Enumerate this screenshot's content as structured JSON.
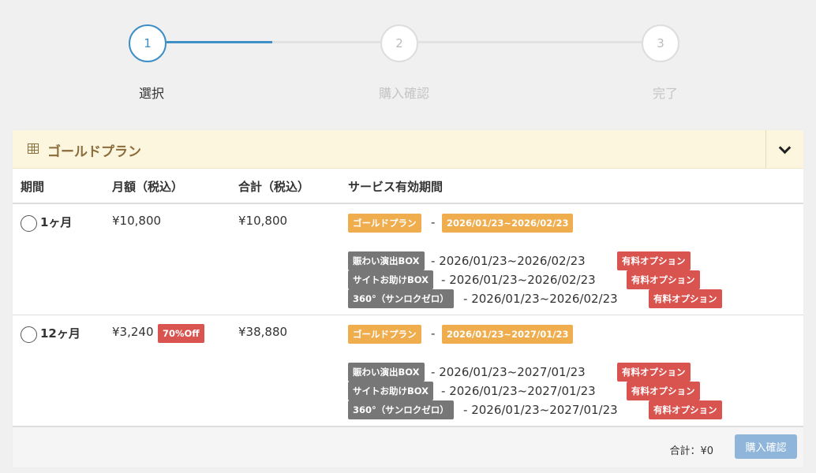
{
  "stepper": {
    "steps": [
      {
        "number": "1",
        "label": "選択"
      },
      {
        "number": "2",
        "label": "購入確認"
      },
      {
        "number": "3",
        "label": "完了"
      }
    ],
    "active_color": "#3d8fc6"
  },
  "panel": {
    "title": "ゴールドプラン",
    "icon": "table-icon",
    "collapse_icon": "chevron-down-icon"
  },
  "table": {
    "headers": [
      "期間",
      "月額（税込）",
      "合計（税込）",
      "サービス有効期間"
    ],
    "rows": [
      {
        "period": "1ヶ月",
        "monthly": "¥10,800",
        "discount": "",
        "total": "¥10,800",
        "plan_badge": "ゴールドプラン",
        "plan_dates": "2026/01/23~2026/02/23",
        "options": [
          {
            "name": "賑わい演出BOX",
            "dates": "2026/01/23~2026/02/23",
            "tag": "有料オプション"
          },
          {
            "name": "サイトお助けBOX",
            "dates": "2026/01/23~2026/02/23",
            "tag": "有料オプション"
          },
          {
            "name": "360°（サンロクゼロ）",
            "dates": "2026/01/23~2026/02/23",
            "tag": "有料オプション"
          }
        ]
      },
      {
        "period": "12ヶ月",
        "monthly": "¥3,240",
        "discount": "70%Off",
        "total": "¥38,880",
        "plan_badge": "ゴールドプラン",
        "plan_dates": "2026/01/23~2027/01/23",
        "options": [
          {
            "name": "賑わい演出BOX",
            "dates": "2026/01/23~2027/01/23",
            "tag": "有料オプション"
          },
          {
            "name": "サイトお助けBOX",
            "dates": "2026/01/23~2027/01/23",
            "tag": "有料オプション"
          },
          {
            "name": "360°（サンロクゼロ）",
            "dates": "2026/01/23~2027/01/23",
            "tag": "有料オプション"
          }
        ]
      }
    ]
  },
  "footer": {
    "total_label": "合計：¥0",
    "buy_button": "購入確認"
  },
  "colors": {
    "gold_badge": "#f0ad4e",
    "gray_badge": "#777777",
    "red_badge": "#d9534f",
    "header_bg": "#fdf6de"
  }
}
